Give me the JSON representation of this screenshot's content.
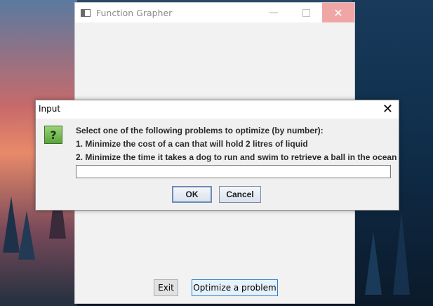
{
  "main_window": {
    "title": "Function Grapher",
    "controls": {
      "minimize": "—",
      "maximize": "",
      "close": "✕"
    },
    "buttons": {
      "exit": "Exit",
      "optimize": "Optimize a problem"
    }
  },
  "dialog": {
    "title": "Input",
    "close": "✕",
    "icon": "question-icon",
    "icon_glyph": "?",
    "message_lines": [
      "Select one of the following problems to optimize (by number):",
      "1. Minimize the cost of a can that will hold 2 litres of liquid",
      "2. Minimize the time it takes a dog to run and swim to retrieve a ball in the ocean"
    ],
    "input_value": "",
    "buttons": {
      "ok": "OK",
      "cancel": "Cancel"
    }
  }
}
